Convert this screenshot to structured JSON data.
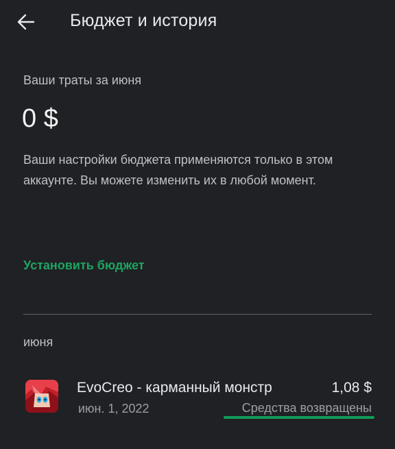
{
  "header": {
    "back_icon": "arrow-left-icon",
    "title": "Бюджет и история"
  },
  "summary": {
    "spend_label": "Ваши траты за июня",
    "amount": "0 $",
    "note": "Ваши настройки бюджета применяются только в этом аккаунте. Вы можете изменить их в любой момент.",
    "set_budget_label": "Установить бюджет",
    "accent_color": "#1ea362"
  },
  "history": {
    "month": "июня",
    "items": [
      {
        "icon": "evocreo-app-icon",
        "name": "EvoCreo - карманный монстр",
        "date": "июн. 1, 2022",
        "price": "1,08 $",
        "status": "Средства возвращены"
      }
    ]
  }
}
